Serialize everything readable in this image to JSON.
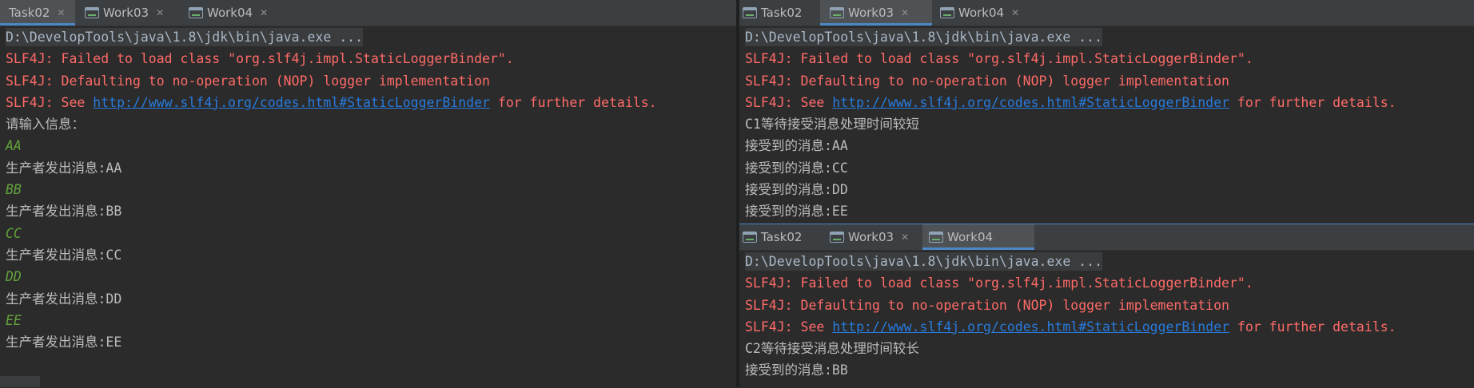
{
  "left_panel": {
    "tabs": [
      {
        "label": "Task02",
        "active": true
      },
      {
        "label": "Work03",
        "active": false
      },
      {
        "label": "Work04",
        "active": false
      }
    ],
    "lines": [
      {
        "kind": "cmd",
        "text": "D:\\DevelopTools\\java\\1.8\\jdk\\bin\\java.exe ..."
      },
      {
        "kind": "red",
        "text": "SLF4J: Failed to load class \"org.slf4j.impl.StaticLoggerBinder\"."
      },
      {
        "kind": "red",
        "text": "SLF4J: Defaulting to no-operation (NOP) logger implementation"
      },
      {
        "kind": "redlink",
        "pre": "SLF4J: See ",
        "link": "http://www.slf4j.org/codes.html#StaticLoggerBinder",
        "post": " for further details."
      },
      {
        "kind": "plain",
        "text": "请输入信息："
      },
      {
        "kind": "green",
        "text": "AA"
      },
      {
        "kind": "plain",
        "text": "生产者发出消息:AA"
      },
      {
        "kind": "green",
        "text": "BB"
      },
      {
        "kind": "plain",
        "text": "生产者发出消息:BB"
      },
      {
        "kind": "green",
        "text": "CC"
      },
      {
        "kind": "plain",
        "text": "生产者发出消息:CC"
      },
      {
        "kind": "green",
        "text": "DD"
      },
      {
        "kind": "plain",
        "text": "生产者发出消息:DD"
      },
      {
        "kind": "green",
        "text": "EE"
      },
      {
        "kind": "plain",
        "text": "生产者发出消息:EE"
      }
    ]
  },
  "right_top_panel": {
    "tabs": [
      {
        "label": "Task02",
        "active": false
      },
      {
        "label": "Work03",
        "active": true
      },
      {
        "label": "Work04",
        "active": false
      }
    ],
    "lines": [
      {
        "kind": "cmd",
        "text": "D:\\DevelopTools\\java\\1.8\\jdk\\bin\\java.exe ..."
      },
      {
        "kind": "red",
        "text": "SLF4J: Failed to load class \"org.slf4j.impl.StaticLoggerBinder\"."
      },
      {
        "kind": "red",
        "text": "SLF4J: Defaulting to no-operation (NOP) logger implementation"
      },
      {
        "kind": "redlink",
        "pre": "SLF4J: See ",
        "link": "http://www.slf4j.org/codes.html#StaticLoggerBinder",
        "post": " for further details."
      },
      {
        "kind": "plain",
        "text": "C1等待接受消息处理时间较短"
      },
      {
        "kind": "plain",
        "text": "接受到的消息:AA"
      },
      {
        "kind": "plain",
        "text": "接受到的消息:CC"
      },
      {
        "kind": "plain",
        "text": "接受到的消息:DD"
      },
      {
        "kind": "plain",
        "text": "接受到的消息:EE"
      }
    ]
  },
  "right_bottom_panel": {
    "tabs": [
      {
        "label": "Task02",
        "active": false
      },
      {
        "label": "Work03",
        "active": false
      },
      {
        "label": "Work04",
        "active": true
      }
    ],
    "lines": [
      {
        "kind": "cmd",
        "text": "D:\\DevelopTools\\java\\1.8\\jdk\\bin\\java.exe ..."
      },
      {
        "kind": "red",
        "text": "SLF4J: Failed to load class \"org.slf4j.impl.StaticLoggerBinder\"."
      },
      {
        "kind": "red",
        "text": "SLF4J: Defaulting to no-operation (NOP) logger implementation"
      },
      {
        "kind": "redlink",
        "pre": "SLF4J: See ",
        "link": "http://www.slf4j.org/codes.html#StaticLoggerBinder",
        "post": " for further details."
      },
      {
        "kind": "plain",
        "text": "C2等待接受消息处理时间较长"
      },
      {
        "kind": "plain",
        "text": "接受到的消息:BB"
      }
    ]
  },
  "colors": {
    "background": "#2b2b2b",
    "error_text": "#ff6b68",
    "input_echo": "#62a23c",
    "link": "#287bde",
    "active_tab_underline": "#4a88c7"
  },
  "icons": {
    "run_config": "window-icon",
    "close": "close-icon"
  }
}
